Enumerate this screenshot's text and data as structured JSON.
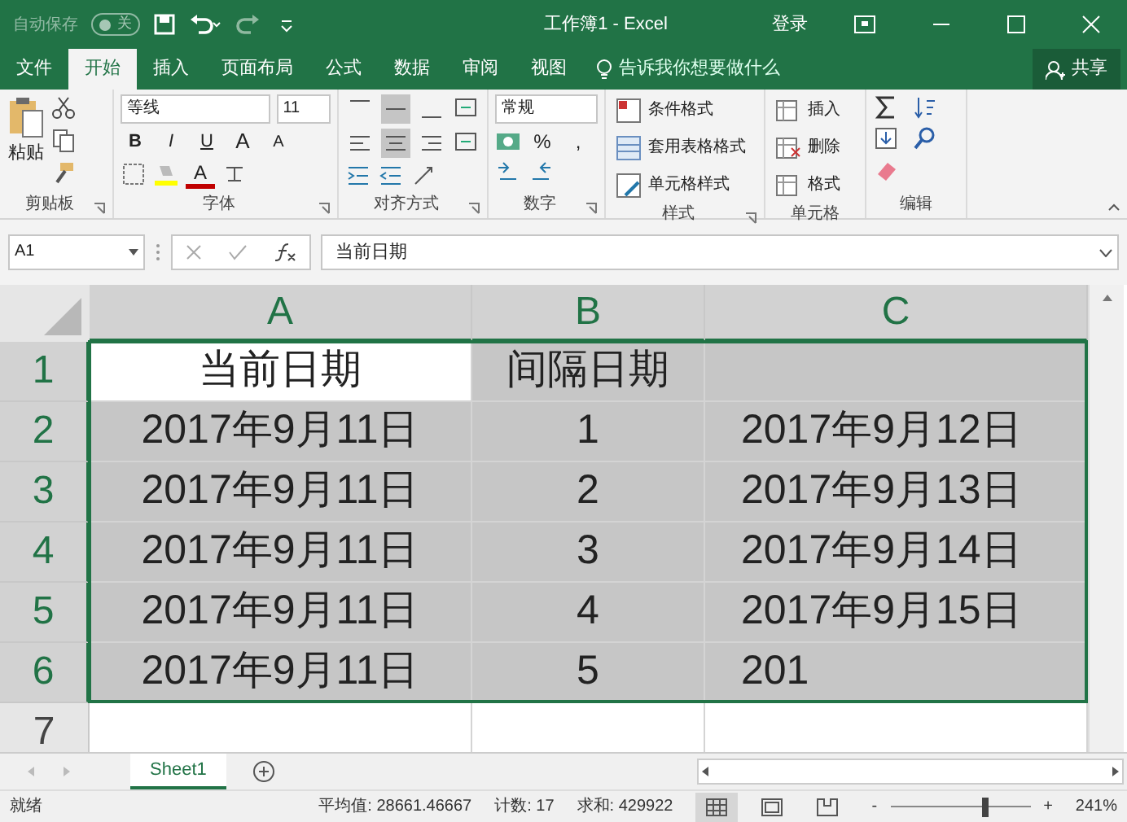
{
  "title_bar": {
    "autosave": {
      "label": "自动保存",
      "on": false,
      "state_text": "关"
    },
    "title": "工作簿1 - Excel",
    "sign_in": "登录"
  },
  "tabs": [
    {
      "label": "文件",
      "selected": false
    },
    {
      "label": "开始",
      "selected": true
    },
    {
      "label": "插入",
      "selected": false
    },
    {
      "label": "页面布局",
      "selected": false
    },
    {
      "label": "公式",
      "selected": false
    },
    {
      "label": "数据",
      "selected": false
    },
    {
      "label": "审阅",
      "selected": false
    },
    {
      "label": "视图",
      "selected": false
    }
  ],
  "tell_me": "告诉我你想要做什么",
  "share": "共享",
  "ribbon": {
    "clipboard": {
      "label": "剪贴板",
      "paste": "粘贴"
    },
    "font": {
      "label": "字体",
      "font_name": "等线",
      "font_size": "11",
      "style_buttons": [
        "B",
        "I",
        "U"
      ],
      "size_buttons": [
        "A",
        "A"
      ],
      "color_button": "A"
    },
    "alignment": {
      "label": "对齐方式",
      "vertical": [
        {
          "selected": false
        },
        {
          "selected": true
        },
        {
          "selected": false
        }
      ],
      "horizontal": [
        {
          "selected": false
        },
        {
          "selected": true
        },
        {
          "selected": false
        }
      ]
    },
    "number": {
      "label": "数字",
      "format": "常规",
      "symbols": [
        "%",
        ","
      ]
    },
    "styles": {
      "label": "样式",
      "items": [
        "条件格式",
        "套用表格格式",
        "单元格样式"
      ]
    },
    "cells": {
      "label": "单元格",
      "items": [
        "插入",
        "删除",
        "格式"
      ]
    },
    "editing": {
      "label": "编辑"
    }
  },
  "formula_bar": {
    "name_box": "A1",
    "formula": "当前日期"
  },
  "grid": {
    "columns": [
      {
        "label": "A",
        "selected": true
      },
      {
        "label": "B",
        "selected": true
      },
      {
        "label": "C",
        "selected": true
      }
    ],
    "rows": [
      {
        "number": "1",
        "selected": true,
        "cells": [
          {
            "text": "当前日期",
            "selected": true,
            "active": true
          },
          {
            "text": "间隔日期",
            "selected": true,
            "active": false
          },
          {
            "text": "",
            "selected": true,
            "active": false
          }
        ]
      },
      {
        "number": "2",
        "selected": true,
        "cells": [
          {
            "text": "2017年9月11日",
            "selected": true,
            "active": false
          },
          {
            "text": "1",
            "selected": true,
            "active": false
          },
          {
            "text": "2017年9月12日",
            "selected": true,
            "active": false
          }
        ]
      },
      {
        "number": "3",
        "selected": true,
        "cells": [
          {
            "text": "2017年9月11日",
            "selected": true,
            "active": false
          },
          {
            "text": "2",
            "selected": true,
            "active": false
          },
          {
            "text": "2017年9月13日",
            "selected": true,
            "active": false
          }
        ]
      },
      {
        "number": "4",
        "selected": true,
        "cells": [
          {
            "text": "2017年9月11日",
            "selected": true,
            "active": false
          },
          {
            "text": "3",
            "selected": true,
            "active": false
          },
          {
            "text": "2017年9月14日",
            "selected": true,
            "active": false
          }
        ]
      },
      {
        "number": "5",
        "selected": true,
        "cells": [
          {
            "text": "2017年9月11日",
            "selected": true,
            "active": false
          },
          {
            "text": "4",
            "selected": true,
            "active": false
          },
          {
            "text": "2017年9月15日",
            "selected": true,
            "active": false
          }
        ]
      },
      {
        "number": "6",
        "selected": true,
        "cells": [
          {
            "text": "2017年9月11日",
            "selected": true,
            "active": false
          },
          {
            "text": "5",
            "selected": true,
            "active": false
          },
          {
            "text": "201",
            "selected": true,
            "active": false
          }
        ]
      },
      {
        "number": "7",
        "selected": false,
        "cells": [
          {
            "text": "",
            "selected": false
          },
          {
            "text": "",
            "selected": false
          },
          {
            "text": "",
            "selected": false
          }
        ]
      }
    ]
  },
  "sheets": [
    {
      "label": "Sheet1",
      "selected": true
    }
  ],
  "status_bar": {
    "state": "就绪",
    "average": "平均值: 28661.46667",
    "count": "计数: 17",
    "sum": "求和: 429922",
    "views": [
      {
        "selected": true
      },
      {
        "selected": false
      },
      {
        "selected": false
      }
    ],
    "zoom_out": "-",
    "zoom_in": "+",
    "zoom": {
      "level": 0.68
    },
    "zoom_text": "241%"
  }
}
